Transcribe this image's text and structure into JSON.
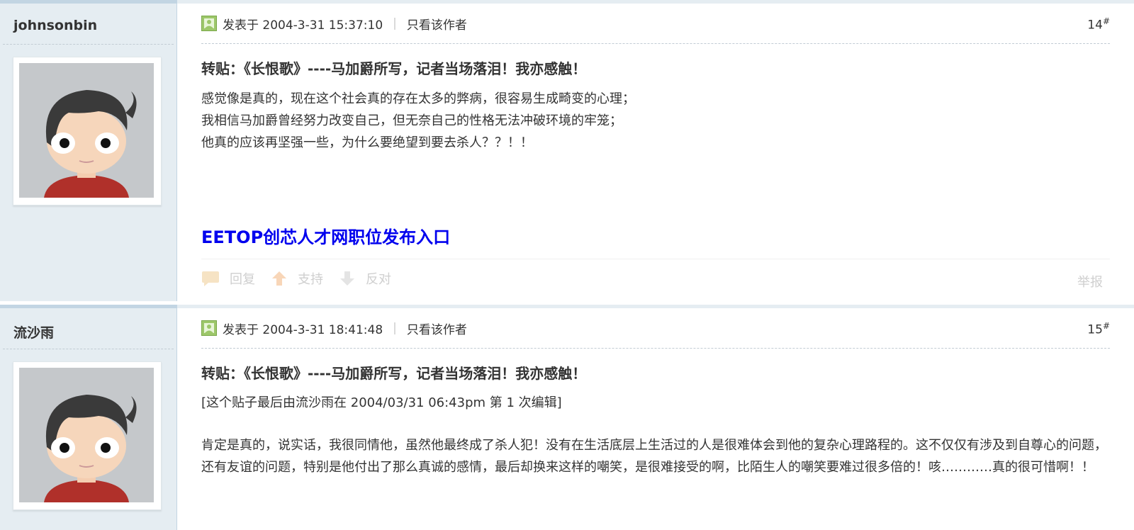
{
  "posts": [
    {
      "author": "johnsonbin",
      "posted_at": "发表于 2004-3-31 15:37:10",
      "only_author": "只看该作者",
      "floor": "14",
      "floor_mark": "#",
      "title": "转贴：《长恨歌》----马加爵所写，记者当场落泪！我亦感触！",
      "lines": [
        "感觉像是真的，现在这个社会真的存在太多的弊病，很容易生成畸变的心理；",
        "我相信马加爵曾经努力改变自己，但无奈自己的性格无法冲破环境的牢笼；",
        "他真的应该再坚强一些，为什么要绝望到要去杀人？？！！"
      ],
      "promo_link": "EETOP创芯人才网职位发布入口",
      "actions": {
        "reply": "回复",
        "support": "支持",
        "oppose": "反对",
        "report": "举报"
      }
    },
    {
      "author": "流沙雨",
      "posted_at": "发表于 2004-3-31 18:41:48",
      "only_author": "只看该作者",
      "floor": "15",
      "floor_mark": "#",
      "title": "转贴：《长恨歌》----马加爵所写，记者当场落泪！我亦感触！",
      "edit_note": "[这个贴子最后由流沙雨在 2004/03/31 06:43pm 第 1 次编辑]",
      "body": "肯定是真的，说实话，我很同情他，虽然他最终成了杀人犯！没有在生活底层上生活过的人是很难体会到他的复杂心理路程的。这不仅仅有涉及到自尊心的问题，还有友谊的问题，特别是他付出了那么真诚的感情，最后却换来这样的嘲笑，是很难接受的啊，比陌生人的嘲笑要难过很多倍的！咳…………真的很可惜啊！！"
    }
  ],
  "icons": {
    "post_icon": "post-icon",
    "reply_icon": "reply-icon",
    "support_icon": "thumb-up-arrow-icon",
    "oppose_icon": "thumb-down-arrow-icon"
  },
  "colors": {
    "sidebar_bg": "#e5edf2",
    "link_blue": "#0000ee",
    "action_gray": "#cfcfcf"
  }
}
